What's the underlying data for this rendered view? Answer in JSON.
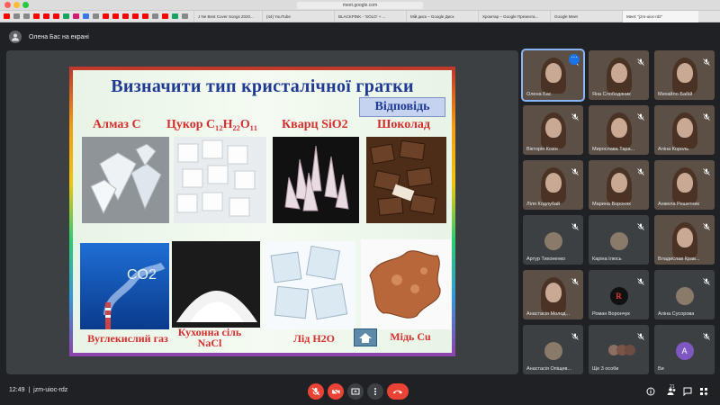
{
  "browser": {
    "url": "meet.google.com",
    "tabs": [
      {
        "label": "J Ne Best Cover Songs 2020...",
        "icon": "youtube-icon"
      },
      {
        "label": "(44) YouTube",
        "icon": "youtube-icon"
      },
      {
        "label": "BLACKPINK - 'SOLO' + ...",
        "icon": "youtube-icon"
      },
      {
        "label": "Мій диск – Google Диск",
        "icon": "drive-icon"
      },
      {
        "label": "Хромтар – Google Презента...",
        "icon": "slides-icon"
      },
      {
        "label": "Google Meet",
        "icon": "meet-icon"
      },
      {
        "label": "Meet: \"jzm-uioc-rdz\"",
        "icon": "meet-icon"
      }
    ]
  },
  "meet": {
    "presenter_label": "Олена Бас на екрані",
    "time": "12:49",
    "meeting_code": "jzm-uioc-rdz",
    "participant_count": "21"
  },
  "slide": {
    "title": "Визначити тип кристалічної гратки",
    "answer_button": "Відповідь",
    "items_top": [
      {
        "label": "Алмаз С"
      },
      {
        "label": "Цукор С₁₂Н₂₂О₁₁"
      },
      {
        "label": "Кварц SiO2"
      },
      {
        "label": "Шоколад"
      }
    ],
    "items_bottom": [
      {
        "label": "Вуглекислий газ"
      },
      {
        "label": "Кухонна сіль NaCl"
      },
      {
        "label": "Лід H2O"
      },
      {
        "label": "Мідь Cu"
      }
    ],
    "co2_text": "CO2",
    "colors": {
      "title": "#1f3a93",
      "labels": "#d32f2f",
      "border": "#9c27b0"
    }
  },
  "participants": [
    {
      "name": "Олена Бас",
      "type": "camera"
    },
    {
      "name": "Яна Слободяник",
      "type": "camera"
    },
    {
      "name": "Михайло Бабій",
      "type": "camera"
    },
    {
      "name": "Вікторія Козін",
      "type": "camera"
    },
    {
      "name": "Мирослава Тара...",
      "type": "camera"
    },
    {
      "name": "Аліна Король",
      "type": "camera"
    },
    {
      "name": "Ліля Кодлубай",
      "type": "camera"
    },
    {
      "name": "Марина Вороняк",
      "type": "camera"
    },
    {
      "name": "Анжела Решетник",
      "type": "camera"
    },
    {
      "name": "Артур Тихоненко",
      "type": "avatar"
    },
    {
      "name": "Каріна Ілюсь",
      "type": "avatar"
    },
    {
      "name": "Владислав Крав...",
      "type": "camera"
    },
    {
      "name": "Анастасія Молод...",
      "type": "camera"
    },
    {
      "name": "Роман Ворончук",
      "type": "avatar",
      "initial": "R"
    },
    {
      "name": "Аліна Сусорова",
      "type": "avatar"
    },
    {
      "name": "Анастасія Опіщев...",
      "type": "avatar"
    },
    {
      "name": "Ще 3 особи",
      "type": "group"
    },
    {
      "name": "Ви",
      "type": "initial",
      "initial": "A"
    }
  ]
}
